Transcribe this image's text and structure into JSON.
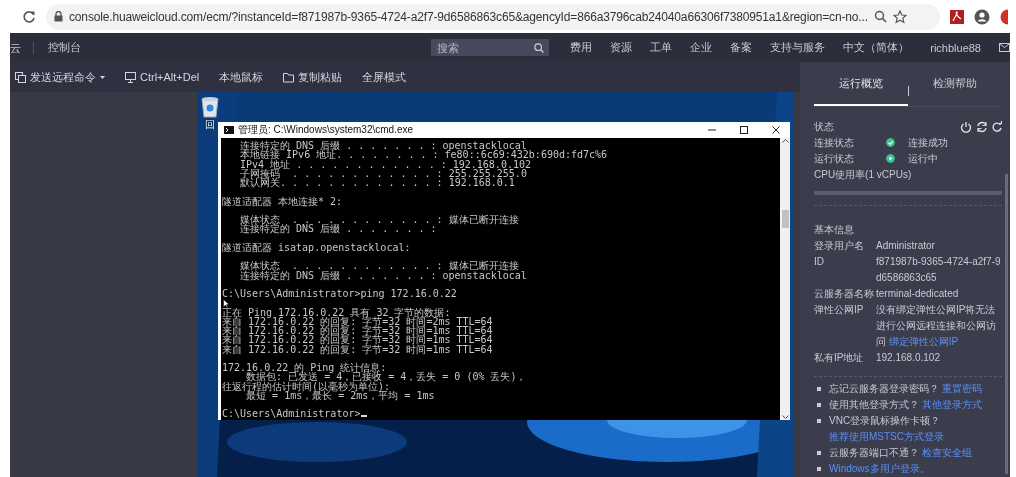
{
  "browser": {
    "url": "console.huaweicloud.com/ecm/?instanceId=f871987b-9365-4724-a2f7-9d6586863c65&agencyId=866a3796cab24040a66306f7380951a1&region=cn-no..."
  },
  "header": {
    "brand": "云",
    "console": "控制台",
    "search": {
      "placeholder": "搜索"
    },
    "nav": [
      "费用",
      "资源",
      "工单",
      "企业",
      "备案",
      "支持与服务",
      "中文（简体）"
    ],
    "user": "richblue88"
  },
  "toolbar": [
    {
      "label": "发送远程命令",
      "kind": "command",
      "dropdown": true
    },
    {
      "label": "Ctrl+Alt+Del",
      "kind": "monitor",
      "dropdown": false
    },
    {
      "label": "本地鼠标",
      "kind": "plain",
      "dropdown": false
    },
    {
      "label": "复制粘贴",
      "kind": "folder",
      "dropdown": false
    },
    {
      "label": "全屏模式",
      "kind": "plain",
      "dropdown": false
    }
  ],
  "desktop": {
    "icons": [
      {
        "label": "回"
      }
    ],
    "cmd": {
      "title": "管理员: C:\\Windows\\system32\\cmd.exe",
      "cursor": true,
      "blocks": [
        [
          "   连接特定的 DNS 后缀 . . . . . . . : openstacklocal",
          "   本地链接 IPv6 地址. . . . . . . . : fe80::6c69:432b:690d:fd7c%6",
          "   IPv4 地址 . . . . . . . . . . . . : 192.168.0.102",
          "   子网掩码  . . . . . . . . . . . . : 255.255.255.0",
          "   默认网关. . . . . . . . . . . . . : 192.168.0.1"
        ],
        [
          "隧道适配器 本地连接* 2:"
        ],
        [
          "   媒体状态  . . . . . . . . . . . . : 媒体已断开连接",
          "   连接特定的 DNS 后缀 . . . . . . . :"
        ],
        [
          "隧道适配器 isatap.openstacklocal:"
        ],
        [
          "   媒体状态  . . . . . . . . . . . . : 媒体已断开连接",
          "   连接特定的 DNS 后缀 . . . . . . . : openstacklocal"
        ],
        [
          "C:\\Users\\Administrator>ping 172.16.0.22"
        ],
        [
          "正在 Ping 172.16.0.22 具有 32 字节的数据:",
          "来自 172.16.0.22 的回复: 字节=32 时间=2ms TTL=64",
          "来自 172.16.0.22 的回复: 字节=32 时间=1ms TTL=64",
          "来自 172.16.0.22 的回复: 字节=32 时间=1ms TTL=64",
          "来自 172.16.0.22 的回复: 字节=32 时间=1ms TTL=64"
        ],
        [
          "172.16.0.22 的 Ping 统计信息:",
          "    数据包: 已发送 = 4，已接收 = 4，丢失 = 0 (0% 丢失)，",
          "往返行程的估计时间(以毫秒为单位):",
          "    最短 = 1ms，最长 = 2ms，平均 = 1ms"
        ],
        [
          "C:\\Users\\Administrator>"
        ]
      ]
    }
  },
  "panel": {
    "tabs": [
      {
        "label": "运行概览",
        "selected": true
      },
      {
        "label": "检测帮助",
        "selected": false
      }
    ],
    "status": {
      "title": "状态",
      "rows": [
        {
          "label": "连接状态",
          "value": "连接成功",
          "kind": "check",
          "color": "#3ec28f"
        },
        {
          "label": "运行状态",
          "value": "运行中",
          "kind": "play",
          "color": "#3ec28f"
        }
      ],
      "cpu": "CPU使用率(1 vCPUs)"
    },
    "basic": {
      "title": "基本信息",
      "rows": [
        {
          "label": "登录用户名",
          "value": "Administrator"
        },
        {
          "label": "ID",
          "value": "f871987b-9365-4724-a2f7-9d6586863c65"
        },
        {
          "label": "云服务器名称",
          "value": "terminal-dedicated"
        },
        {
          "label": "弹性公网IP",
          "value": "没有绑定弹性公网IP将无法进行公网远程连接和公网访问",
          "link": "绑定弹性公网IP"
        },
        {
          "label": "私有IP地址",
          "value": "192.168.0.102"
        }
      ]
    },
    "tips": [
      {
        "text": "忘记云服务器登录密码？",
        "link": "重置密码"
      },
      {
        "text": "使用其他登录方式？",
        "link": "其他登录方式"
      },
      {
        "text": "VNC登录鼠标操作卡顿？",
        "link": "推荐使用MSTSC方式登录"
      },
      {
        "text": "云服务器端口不通？",
        "link": "检查安全组"
      },
      {
        "link": "Windows多用户登录。"
      }
    ]
  }
}
